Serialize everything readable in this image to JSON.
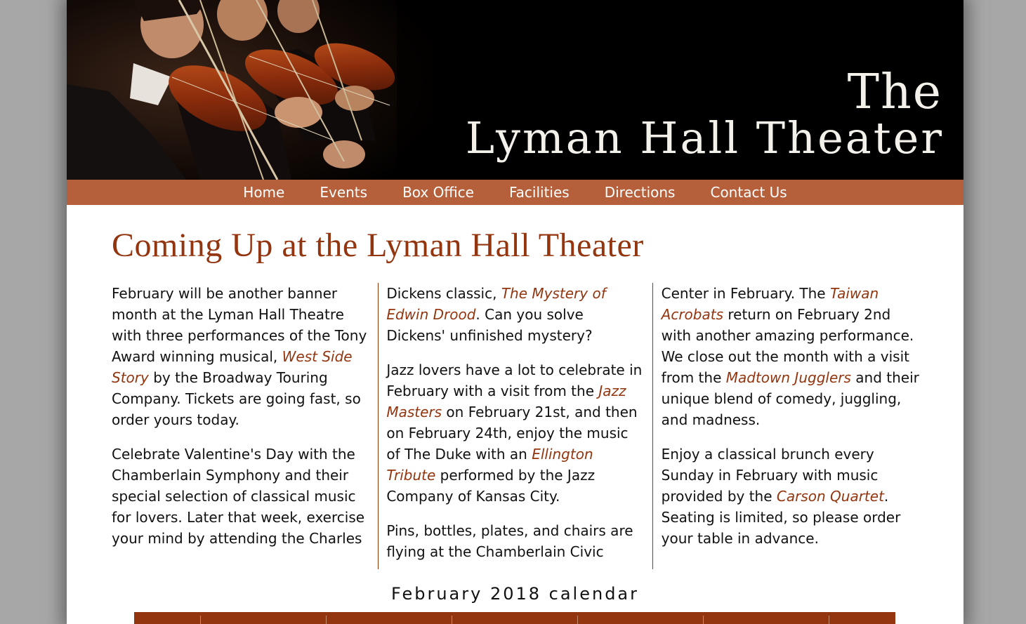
{
  "banner": {
    "title_small": "The",
    "title_large": "Lyman Hall Theater"
  },
  "nav": {
    "items": [
      "Home",
      "Events",
      "Box Office",
      "Facilities",
      "Directions",
      "Contact Us"
    ]
  },
  "main": {
    "heading": "Coming Up at the Lyman Hall Theater",
    "paragraphs": {
      "p1": {
        "a": "February will be another banner month at the Lyman Hall Theatre with three performances of the Tony Award winning musical, ",
        "em": "West Side Story",
        "b": " by the Broadway Touring Company. Tickets are going fast, so order yours today."
      },
      "p2": {
        "a": "Celebrate Valentine's Day with the Chamberlain Symphony and their special selection of classical music for lovers. Later that week, exercise your mind by attending the Charles Dickens classic, ",
        "em": "The Mystery of Edwin Drood",
        "b": ". Can you solve Dickens' unfinished mystery?"
      },
      "p3": {
        "a": "Jazz lovers have a lot to celebrate in February with a visit from the ",
        "em1": "Jazz Masters",
        "b": " on February 21st, and then on February 24th, enjoy the music of The Duke with an ",
        "em2": "Ellington Tribute",
        "c": " performed by the Jazz Company of Kansas City."
      },
      "p4": {
        "a": "Pins, bottles, plates, and chairs are flying at the Chamberlain Civic Center in February. The ",
        "em1": "Taiwan Acrobats",
        "b": " return on February 2nd with another amazing performance. We close out the month with a visit from the ",
        "em2": "Madtown Jugglers",
        "c": " and their unique blend of comedy, juggling, and madness."
      },
      "p5": {
        "a": "Enjoy a classical brunch every Sunday in February with music provided by the ",
        "em": "Carson Quartet",
        "b": ". Seating is limited, so please order your table in advance."
      }
    }
  },
  "calendar": {
    "caption": "February 2018 calendar"
  },
  "colors": {
    "accent": "#93350f",
    "nav_bg": "#b5603a",
    "page_bg": "#a7a7a7"
  }
}
